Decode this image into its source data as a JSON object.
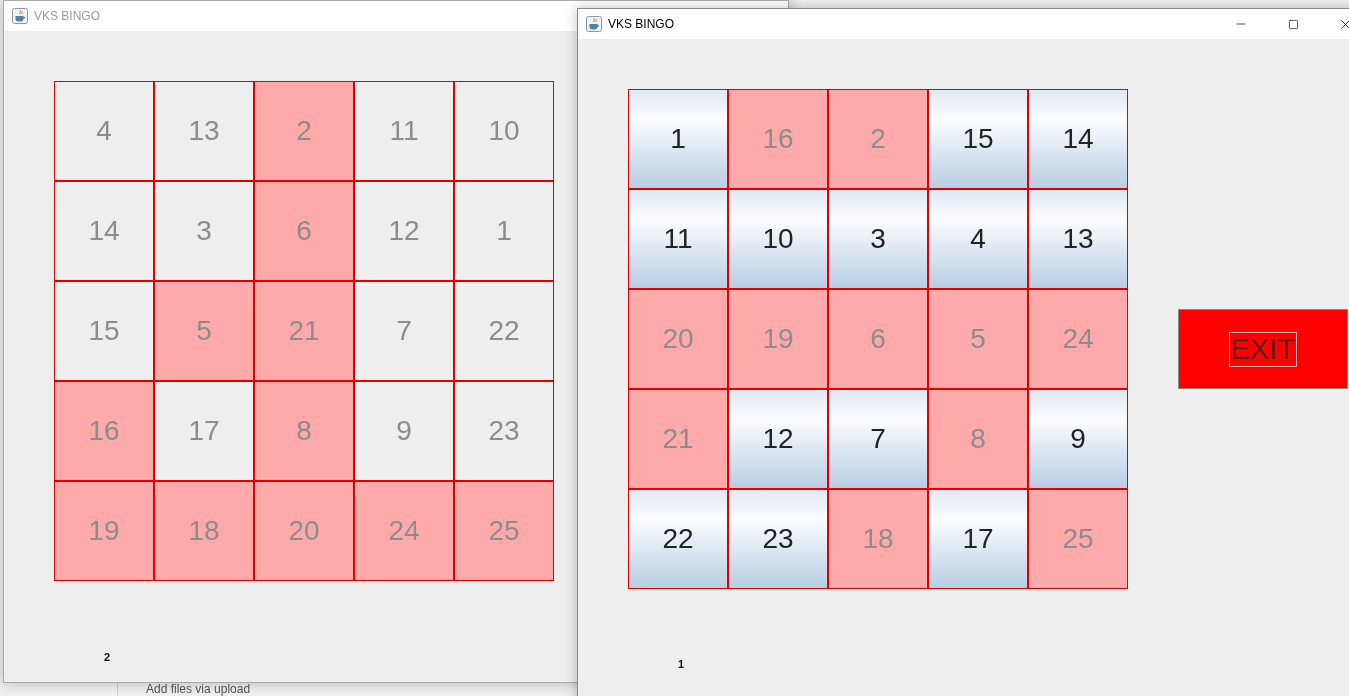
{
  "backdrop": {
    "text": "Add files via upload"
  },
  "windows": [
    {
      "title": "VKS BINGO",
      "active": false,
      "status_label": "2",
      "board": [
        [
          {
            "number": "4",
            "marked": false
          },
          {
            "number": "13",
            "marked": false
          },
          {
            "number": "2",
            "marked": true
          },
          {
            "number": "11",
            "marked": false
          },
          {
            "number": "10",
            "marked": false
          }
        ],
        [
          {
            "number": "14",
            "marked": false
          },
          {
            "number": "3",
            "marked": false
          },
          {
            "number": "6",
            "marked": true
          },
          {
            "number": "12",
            "marked": false
          },
          {
            "number": "1",
            "marked": false
          }
        ],
        [
          {
            "number": "15",
            "marked": false
          },
          {
            "number": "5",
            "marked": true
          },
          {
            "number": "21",
            "marked": true
          },
          {
            "number": "7",
            "marked": false
          },
          {
            "number": "22",
            "marked": false
          }
        ],
        [
          {
            "number": "16",
            "marked": true
          },
          {
            "number": "17",
            "marked": false
          },
          {
            "number": "8",
            "marked": true
          },
          {
            "number": "9",
            "marked": false
          },
          {
            "number": "23",
            "marked": false
          }
        ],
        [
          {
            "number": "19",
            "marked": true
          },
          {
            "number": "18",
            "marked": true
          },
          {
            "number": "20",
            "marked": true
          },
          {
            "number": "24",
            "marked": true
          },
          {
            "number": "25",
            "marked": true
          }
        ]
      ]
    },
    {
      "title": "VKS BINGO",
      "active": true,
      "status_label": "1",
      "exit_button": "EXIT",
      "board": [
        [
          {
            "number": "1",
            "marked": false
          },
          {
            "number": "16",
            "marked": true
          },
          {
            "number": "2",
            "marked": true
          },
          {
            "number": "15",
            "marked": false
          },
          {
            "number": "14",
            "marked": false
          }
        ],
        [
          {
            "number": "11",
            "marked": false
          },
          {
            "number": "10",
            "marked": false
          },
          {
            "number": "3",
            "marked": false
          },
          {
            "number": "4",
            "marked": false
          },
          {
            "number": "13",
            "marked": false
          }
        ],
        [
          {
            "number": "20",
            "marked": true
          },
          {
            "number": "19",
            "marked": true
          },
          {
            "number": "6",
            "marked": true
          },
          {
            "number": "5",
            "marked": true
          },
          {
            "number": "24",
            "marked": true
          }
        ],
        [
          {
            "number": "21",
            "marked": true
          },
          {
            "number": "12",
            "marked": false
          },
          {
            "number": "7",
            "marked": false
          },
          {
            "number": "8",
            "marked": true
          },
          {
            "number": "9",
            "marked": false
          }
        ],
        [
          {
            "number": "22",
            "marked": false
          },
          {
            "number": "23",
            "marked": false
          },
          {
            "number": "18",
            "marked": true
          },
          {
            "number": "17",
            "marked": false
          },
          {
            "number": "25",
            "marked": true
          }
        ]
      ]
    }
  ]
}
